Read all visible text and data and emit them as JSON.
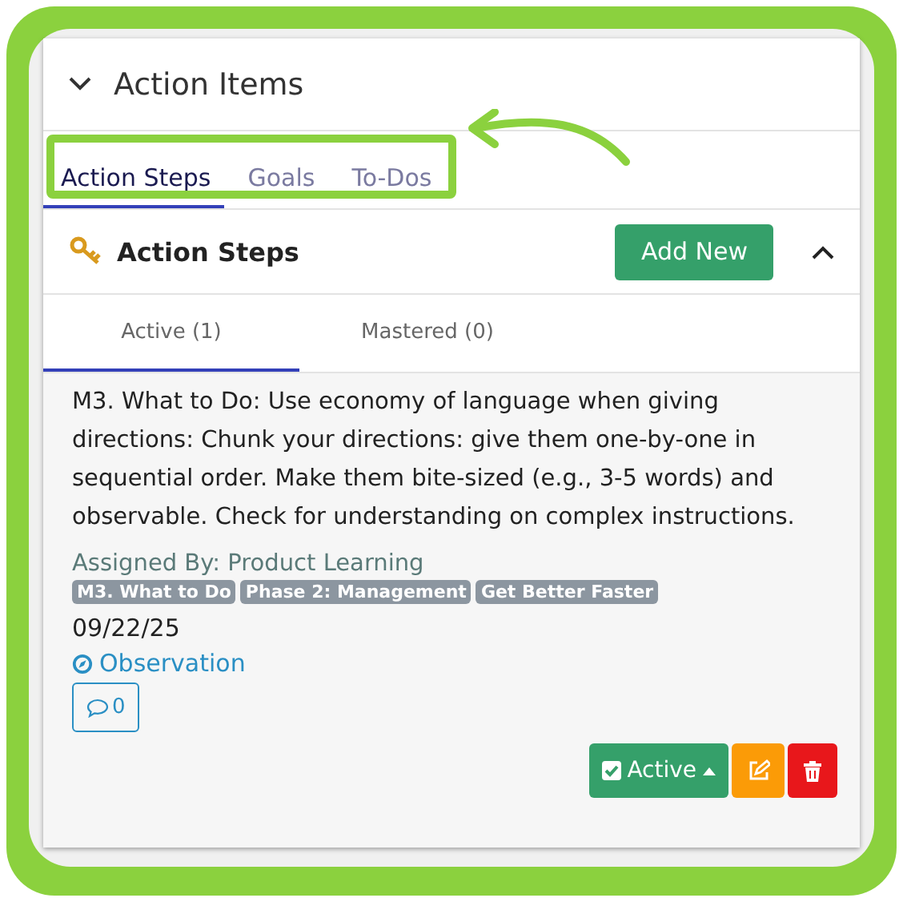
{
  "panel": {
    "title": "Action Items",
    "expanded": true
  },
  "tabs": [
    {
      "label": "Action Steps",
      "selected": true
    },
    {
      "label": "Goals",
      "selected": false
    },
    {
      "label": "To-Dos",
      "selected": false
    }
  ],
  "section": {
    "title": "Action Steps",
    "add_button": "Add New",
    "expanded": true
  },
  "subtabs": [
    {
      "label": "Active (1)",
      "selected": true
    },
    {
      "label": "Mastered (0)",
      "selected": false
    }
  ],
  "item": {
    "description": "M3. What to Do: Use economy of language when giving directions: Chunk your directions: give them one-by-one in sequential order. Make them bite-sized (e.g., 3-5 words) and observable. Check for understanding on complex instructions.",
    "assigned_by": "Assigned By: Product Learning",
    "tags": [
      "M3. What to Do",
      "Phase 2: Management",
      "Get Better Faster"
    ],
    "date": "09/22/25",
    "source": "Observation",
    "comments": "0",
    "status": "Active"
  }
}
